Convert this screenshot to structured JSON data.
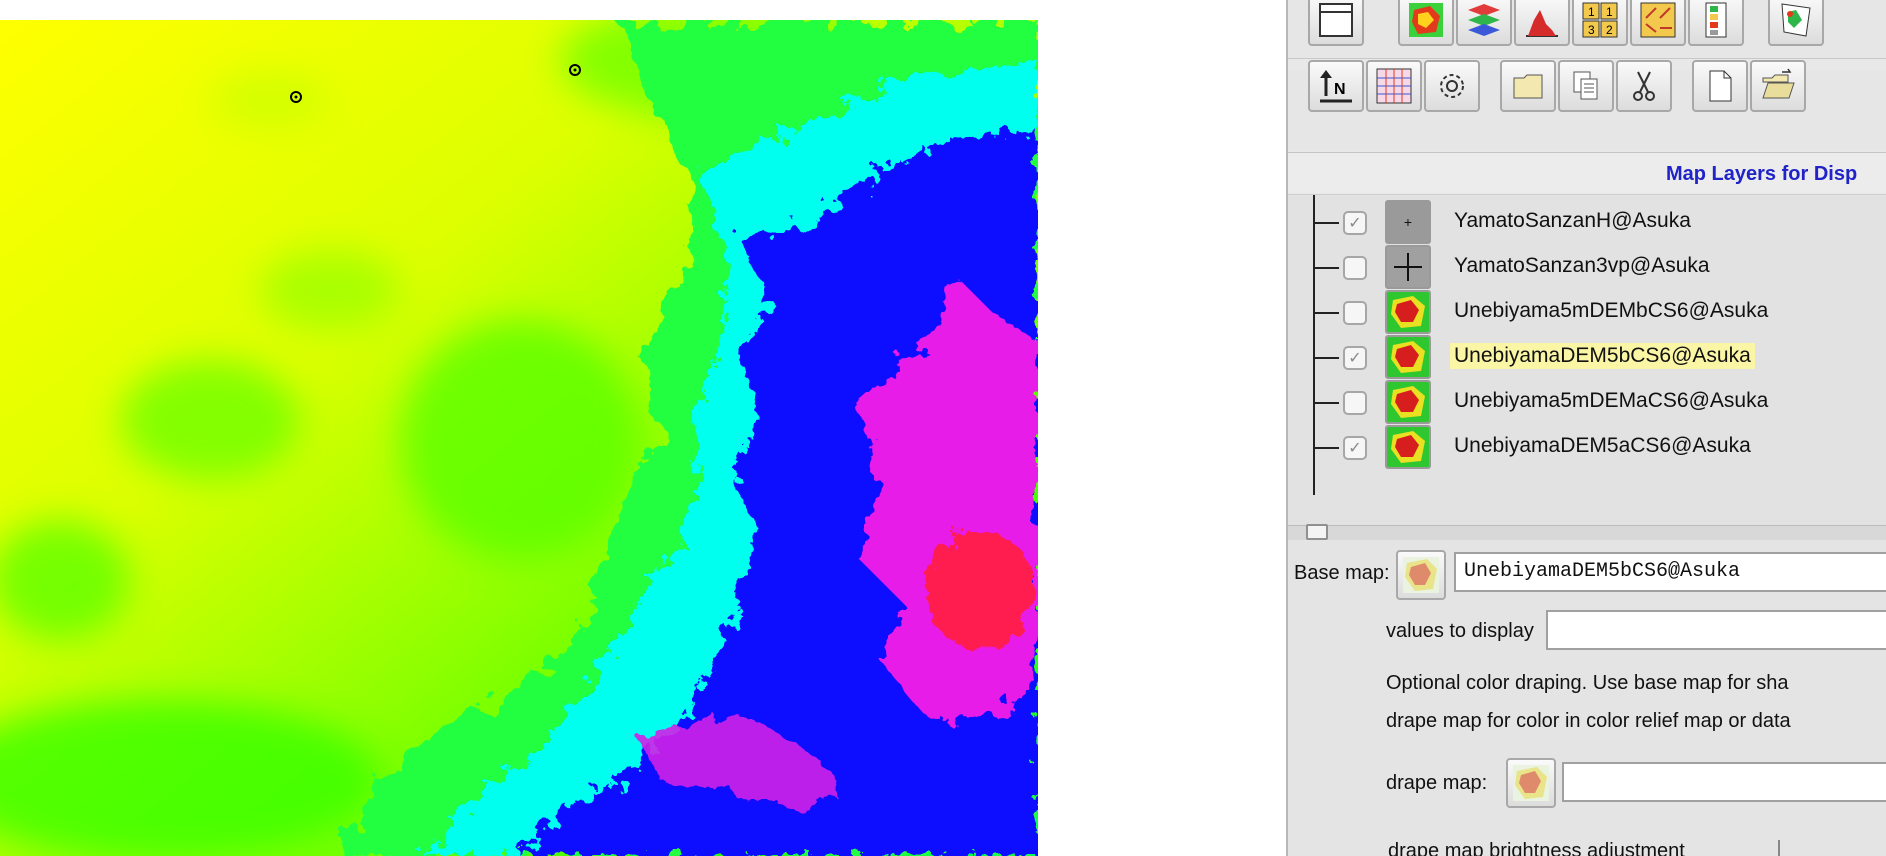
{
  "map_view": {
    "name": "elevation-map-view",
    "color_ramp": [
      "#ffff00",
      "#b8ff00",
      "#00ff00",
      "#00ffff",
      "#0000ff",
      "#ff00ff",
      "#ff0000"
    ],
    "marker_count": 2
  },
  "panel": {
    "title": "Map Layers for Disp",
    "toolbar_row1": [
      "display-icon",
      "raster-map-icon",
      "layers-stack-icon",
      "histogram-icon",
      "table-grid-icon",
      "vector-arrows-icon",
      "legend-icon",
      "georectify-icon"
    ],
    "toolbar_row2": [
      "north-arrow-icon",
      "grid-overlay-icon",
      "gear-icon",
      "folder-icon",
      "copy-icon",
      "cut-icon",
      "new-document-icon",
      "open-folder-icon"
    ]
  },
  "layers": [
    {
      "label": "YamatoSanzanH@Asuka",
      "checked": true,
      "icon": "point-marker-icon",
      "selected": false
    },
    {
      "label": "YamatoSanzan3vp@Asuka",
      "checked": false,
      "icon": "crosshair-icon",
      "selected": false
    },
    {
      "label": "Unebiyama5mDEMbCS6@Asuka",
      "checked": false,
      "icon": "raster-map-icon",
      "selected": false
    },
    {
      "label": "UnebiyamaDEM5bCS6@Asuka",
      "checked": true,
      "icon": "raster-map-icon",
      "selected": true
    },
    {
      "label": "Unebiyama5mDEMaCS6@Asuka",
      "checked": false,
      "icon": "raster-map-icon",
      "selected": false
    },
    {
      "label": "UnebiyamaDEM5aCS6@Asuka",
      "checked": true,
      "icon": "raster-map-icon",
      "selected": false
    }
  ],
  "properties": {
    "base_map_label": "Base map:",
    "base_map_value": "UnebiyamaDEM5bCS6@Asuka",
    "values_label": "values to display",
    "values_value": "",
    "help_line1": "Optional color draping. Use base map for sha",
    "help_line2": "drape map for color in color relief map or data",
    "drape_label": "drape map:",
    "drape_value": "",
    "brightness_label": "drape map brightness adjustment"
  }
}
